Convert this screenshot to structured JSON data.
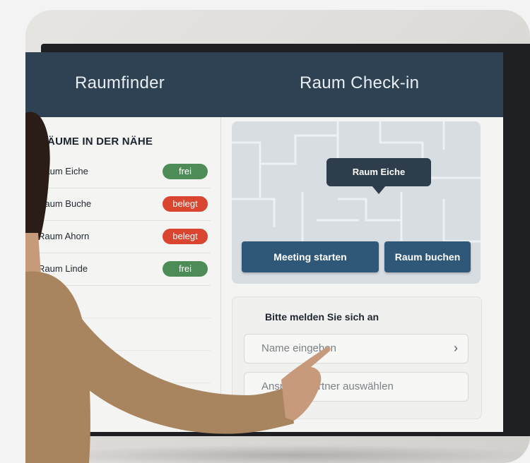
{
  "header": {
    "left_title": "Raumfinder",
    "right_title": "Raum Check-in"
  },
  "rooms_panel": {
    "heading": "RÄUME IN DER NÄHE",
    "rooms": [
      {
        "name": "Raum Eiche",
        "status": "frei",
        "state": "free"
      },
      {
        "name": "Raum Buche",
        "status": "belegt",
        "state": "busy"
      },
      {
        "name": "Raum Ahorn",
        "status": "belegt",
        "state": "busy"
      },
      {
        "name": "Raum Linde",
        "status": "frei",
        "state": "free"
      }
    ]
  },
  "map": {
    "tooltip": "Raum Eiche",
    "meeting_button": "Meeting starten",
    "book_button": "Raum buchen"
  },
  "login": {
    "prompt": "Bitte melden Sie sich an",
    "name_placeholder": "Name eingeben",
    "partner_placeholder": "Ansprechpartner auswählen",
    "chevron": "›"
  },
  "colors": {
    "header_bg": "#2e4254",
    "free": "#4d8c57",
    "busy": "#d9452e",
    "button": "#2f5878"
  },
  "icons": [
    "chevron-right-icon"
  ]
}
